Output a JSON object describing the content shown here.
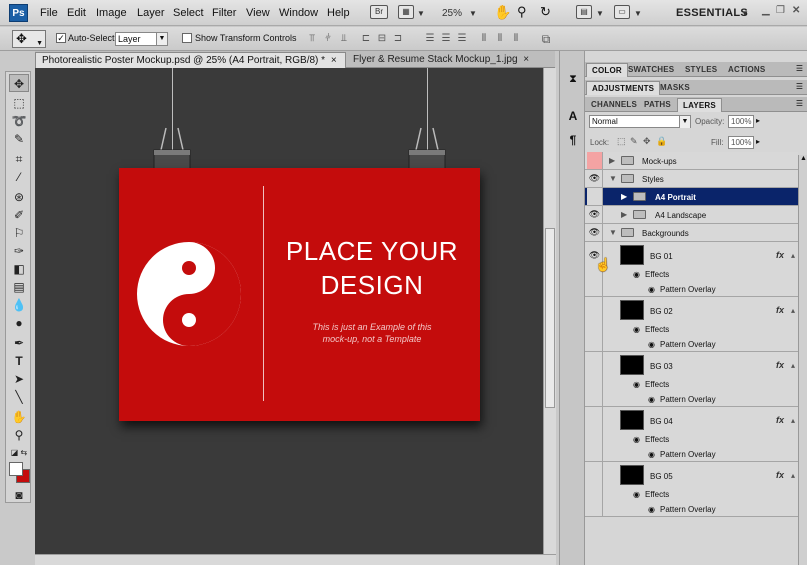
{
  "app": {
    "logo": "Ps"
  },
  "menu": [
    "File",
    "Edit",
    "Image",
    "Layer",
    "Select",
    "Filter",
    "View",
    "Window",
    "Help"
  ],
  "appbar": {
    "br_label": "Br",
    "zoom": "25%",
    "workspace": "ESSENTIALS"
  },
  "options": {
    "auto_select_label": "Auto-Select:",
    "auto_select_checked": true,
    "auto_select_value": "Layer",
    "show_transform_label": "Show Transform Controls",
    "show_transform_checked": false
  },
  "doc_tabs": [
    {
      "label": "Photorealistic Poster Mockup.psd @ 25% (A4 Portrait, RGB/8) *",
      "active": true,
      "close": "×"
    },
    {
      "label": "Flyer & Resume Stack Mockup_1.jpg",
      "active": false,
      "close": "×"
    }
  ],
  "poster": {
    "title_line1": "PLACE YOUR",
    "title_line2": "DESIGN",
    "subtitle_line1": "This is just an Example of this",
    "subtitle_line2": "mock-up, not a Template",
    "background_color": "#c40c0c"
  },
  "panels": {
    "group1_tabs": [
      "COLOR",
      "SWATCHES",
      "STYLES",
      "ACTIONS"
    ],
    "group2_tabs": [
      "ADJUSTMENTS",
      "MASKS"
    ],
    "group3_tabs": [
      "CHANNELS",
      "PATHS",
      "LAYERS"
    ],
    "blend_mode": "Normal",
    "opacity_label": "Opacity:",
    "opacity_value": "100%",
    "lock_label": "Lock:",
    "fill_label": "Fill:",
    "fill_value": "100%"
  },
  "layers": {
    "mockups": "Mock-ups",
    "styles": "Styles",
    "a4_portrait": "A4 Portrait",
    "a4_landscape": "A4 Landscape",
    "backgrounds": "Backgrounds",
    "effects_label": "Effects",
    "pattern_overlay_label": "Pattern Overlay",
    "fx_label": "fx",
    "bg_layers": [
      "BG 01",
      "BG 02",
      "BG 03",
      "BG 04",
      "BG 05"
    ]
  },
  "colors": {
    "selection": "#0a246a",
    "accent_red": "#c40c0c"
  }
}
